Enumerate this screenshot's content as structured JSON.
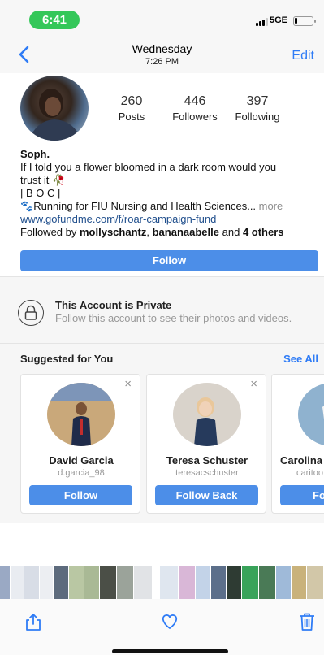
{
  "status_bar": {
    "time": "6:41",
    "network": "5GE"
  },
  "nav": {
    "day": "Wednesday",
    "time": "7:26 PM",
    "edit_label": "Edit"
  },
  "profile": {
    "stats": [
      {
        "value": "260",
        "label": "Posts"
      },
      {
        "value": "446",
        "label": "Followers"
      },
      {
        "value": "397",
        "label": "Following"
      }
    ],
    "name": "Soph.",
    "bio_line1": "If I told you a flower bloomed in a dark room would you",
    "bio_line2": "trust it",
    "bio_emoji": "🥀",
    "bio_line3": "| B O C |",
    "bio_line4_emoji": "🐾",
    "bio_line4": "Running for FIU Nursing and Health Sciences...",
    "bio_more": "more",
    "link": "www.gofundme.com/f/roar-campaign-fund",
    "followed_prefix": "Followed by",
    "followed_user1": "mollyschantz",
    "followed_sep": ",",
    "followed_user2": "bananaabelle",
    "followed_and": "and",
    "followed_others": "4 others",
    "follow_label": "Follow"
  },
  "private": {
    "title": "This Account is Private",
    "subtitle": "Follow this account to see their photos and videos."
  },
  "suggested": {
    "title": "Suggested for You",
    "see_all": "See All",
    "close_glyph": "×",
    "cards": [
      {
        "name": "David Garcia",
        "username": "d.garcia_98",
        "button": "Follow"
      },
      {
        "name": "Teresa Schuster",
        "username": "teresacschuster",
        "button": "Follow Back"
      },
      {
        "name": "Carolina",
        "username": "caritoo",
        "button": "Fo"
      }
    ]
  },
  "colors": {
    "accent": "#2f7cf6",
    "button": "#4c8ee8",
    "status_pill": "#34c759"
  },
  "icons": {
    "toolbar": [
      "share-icon",
      "heart-icon",
      "trash-icon"
    ]
  }
}
